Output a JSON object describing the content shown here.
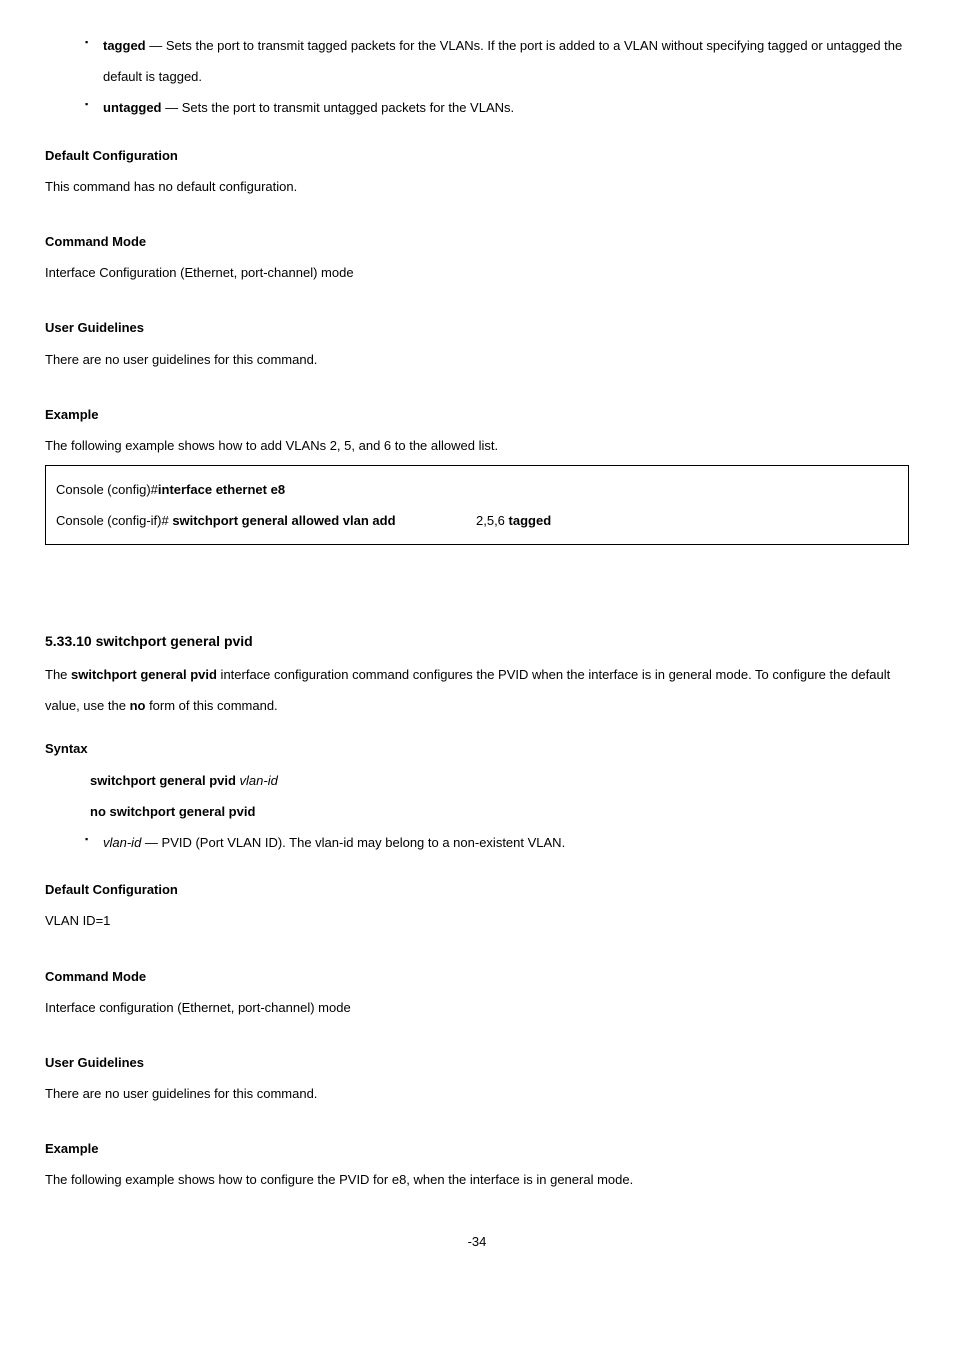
{
  "section1": {
    "bullets": [
      {
        "kw": "tagged",
        "text": " — Sets the port to transmit tagged packets for the VLANs. If the port is added to a VLAN without specifying tagged or untagged the default is tagged."
      },
      {
        "kw": "untagged",
        "text": " — Sets the port to transmit untagged packets for the VLANs."
      }
    ],
    "headings": {
      "default": "Default Configuration",
      "mode": "Command Mode",
      "guide": "User Guidelines",
      "example": "Example"
    },
    "default_text": "This command has no default configuration.",
    "mode_text": "Interface Configuration (Ethernet, port-channel) mode",
    "guide_text": "There are no user guidelines for this command.",
    "example_text": "The following example shows how to add VLANs 2, 5, and 6 to the allowed list.",
    "code": {
      "line1_prompt": "Console (config)# ",
      "line1_cmd": "interface ethernet e8",
      "line2_prompt": "Console (config-if)# ",
      "line2_cmd_a": "switchport general allowed vlan add",
      "line2_ids": " 2,5,6 ",
      "line2_cmd_b": "tagged"
    }
  },
  "section2": {
    "title": "5.33.10 switchport general pvid",
    "desc_a": "The ",
    "desc_cmd": "switchport general pvid",
    "desc_b": " interface configuration command configures the PVID when the interface is in general mode. To configure the default value, use the ",
    "desc_no": "no",
    "desc_c": " form of this command.",
    "syntax_heading": "Syntax",
    "syntax_line1_a": "switchport general pvid ",
    "syntax_line1_b": "vlan-id",
    "syntax_line2": "no switchport general pvid",
    "bullet_kw": "vlan-id",
    "bullet_text": " — PVID (Port VLAN ID). The vlan-id may belong to a non-existent VLAN.",
    "headings": {
      "default": "Default Configuration",
      "mode": "Command Mode",
      "guide": "User Guidelines",
      "example": "Example"
    },
    "default_text": "VLAN ID=1",
    "mode_text": "Interface configuration (Ethernet, port-channel) mode",
    "guide_text": "There are no user guidelines for this command.",
    "example_text": "The following example shows how to configure the PVID for e8, when the interface is in general mode."
  },
  "pagenum": "-34"
}
